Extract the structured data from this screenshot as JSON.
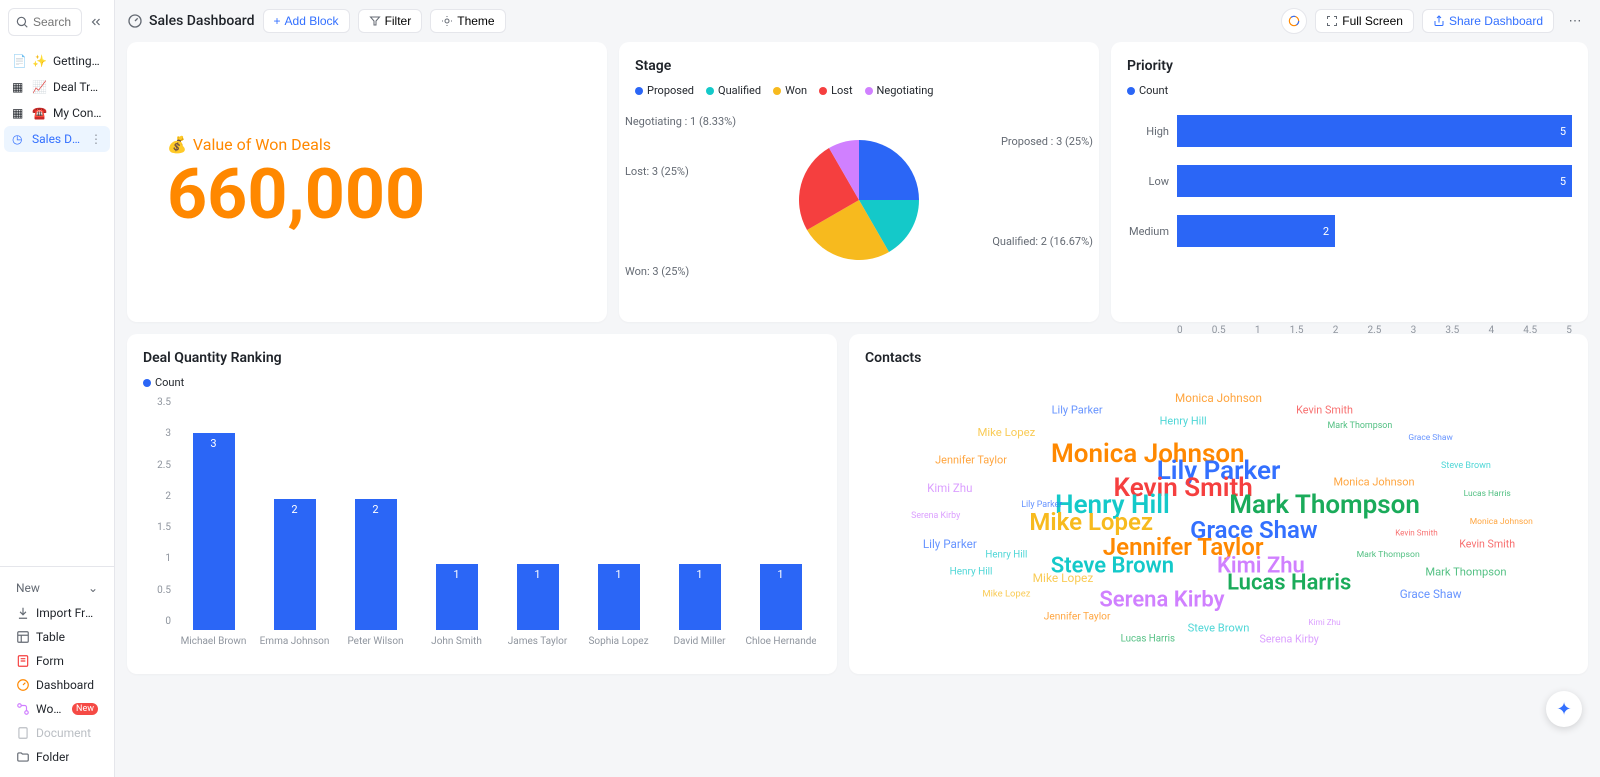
{
  "search": {
    "placeholder": "Search"
  },
  "sidebar": {
    "items": [
      {
        "icon": "✨",
        "label": "Getting Started"
      },
      {
        "icon": "📈",
        "label": "Deal Tracker"
      },
      {
        "icon": "☎️",
        "label": "My Contacts"
      },
      {
        "icon": "🕒",
        "label": "Sales Dashbo..."
      }
    ]
  },
  "sidebar_bottom": {
    "new_label": "New",
    "items": [
      {
        "label": "Import From E...",
        "key": "import"
      },
      {
        "label": "Table",
        "key": "table"
      },
      {
        "label": "Form",
        "key": "form"
      },
      {
        "label": "Dashboard",
        "key": "dashboard"
      },
      {
        "label": "Workflow",
        "key": "workflow",
        "badge": "New"
      },
      {
        "label": "Document",
        "key": "document",
        "disabled": true
      },
      {
        "label": "Folder",
        "key": "folder"
      }
    ]
  },
  "header": {
    "title": "Sales Dashboard",
    "add_block": "Add Block",
    "filter": "Filter",
    "theme": "Theme",
    "full_screen": "Full Screen",
    "share": "Share Dashboard"
  },
  "kpi": {
    "label": "Value of Won Deals",
    "emoji": "💰",
    "value": "660,000"
  },
  "stage": {
    "title": "Stage",
    "legend": [
      "Proposed",
      "Qualified",
      "Won",
      "Lost",
      "Negotiating"
    ],
    "colors": [
      "#2b66f6",
      "#14c9c9",
      "#f7ba1e",
      "#f53f3f",
      "#d080ff"
    ],
    "labels": {
      "negotiating": "Negotiating : 1 (8.33%)",
      "lost": "Lost: 3 (25%)",
      "won": "Won: 3 (25%)",
      "qualified": "Qualified: 2 (16.67%)",
      "proposed": "Proposed : 3 (25%)"
    }
  },
  "priority": {
    "title": "Priority",
    "legend": "Count",
    "ticks": [
      "0",
      "0.5",
      "1",
      "1.5",
      "2",
      "2.5",
      "3",
      "3.5",
      "4",
      "4.5",
      "5"
    ]
  },
  "deal": {
    "title": "Deal Quantity Ranking",
    "legend": "Count",
    "yticks": [
      "3.5",
      "3",
      "2.5",
      "2",
      "1.5",
      "1",
      "0.5",
      "0"
    ]
  },
  "contacts": {
    "title": "Contacts"
  },
  "chart_data": [
    {
      "type": "pie",
      "title": "Stage",
      "series": [
        {
          "name": "Proposed",
          "value": 3,
          "pct": 25.0
        },
        {
          "name": "Qualified",
          "value": 2,
          "pct": 16.67
        },
        {
          "name": "Won",
          "value": 3,
          "pct": 25.0
        },
        {
          "name": "Lost",
          "value": 3,
          "pct": 25.0
        },
        {
          "name": "Negotiating",
          "value": 1,
          "pct": 8.33
        }
      ]
    },
    {
      "type": "bar",
      "orientation": "horizontal",
      "title": "Priority",
      "categories": [
        "High",
        "Low",
        "Medium"
      ],
      "values": [
        5,
        5,
        2
      ],
      "xlim": [
        0,
        5
      ],
      "legend": [
        "Count"
      ]
    },
    {
      "type": "bar",
      "orientation": "vertical",
      "title": "Deal Quantity Ranking",
      "categories": [
        "Michael Brown",
        "Emma Johnson",
        "Peter Wilson",
        "John Smith",
        "James Taylor",
        "Sophia Lopez",
        "David Miller",
        "Chloe Hernandez"
      ],
      "values": [
        3,
        2,
        2,
        1,
        1,
        1,
        1,
        1
      ],
      "ylim": [
        0,
        3.5
      ],
      "legend": [
        "Count"
      ]
    },
    {
      "type": "wordcloud",
      "title": "Contacts",
      "words": [
        {
          "text": "Monica Johnson",
          "size": 26,
          "color": "#ff8800"
        },
        {
          "text": "Lily Parker",
          "size": 26,
          "color": "#3370ff"
        },
        {
          "text": "Kevin Smith",
          "size": 26,
          "color": "#f53f3f"
        },
        {
          "text": "Henry Hill",
          "size": 26,
          "color": "#14c9c9"
        },
        {
          "text": "Mark Thompson",
          "size": 26,
          "color": "#1aab5a"
        },
        {
          "text": "Mike Lopez",
          "size": 24,
          "color": "#f7ba1e"
        },
        {
          "text": "Grace Shaw",
          "size": 24,
          "color": "#3370ff"
        },
        {
          "text": "Jennifer Taylor",
          "size": 24,
          "color": "#ff8800"
        },
        {
          "text": "Steve Brown",
          "size": 22,
          "color": "#14c9c9"
        },
        {
          "text": "Kimi Zhu",
          "size": 22,
          "color": "#d080ff"
        },
        {
          "text": "Lucas Harris",
          "size": 22,
          "color": "#1aab5a"
        },
        {
          "text": "Serena Kirby",
          "size": 22,
          "color": "#d080ff"
        }
      ]
    }
  ]
}
